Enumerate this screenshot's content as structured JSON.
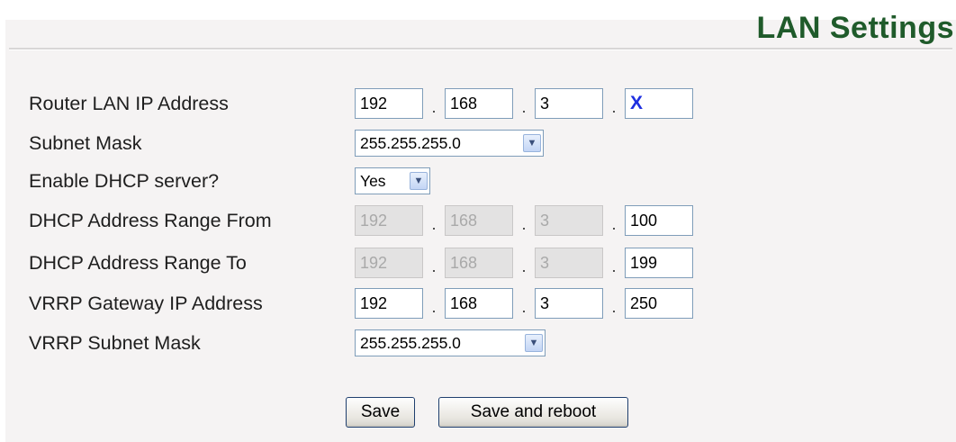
{
  "title": "LAN Settings",
  "rows": {
    "router_ip": {
      "label": "Router LAN IP Address",
      "octets": [
        "192",
        "168",
        "3",
        "X"
      ]
    },
    "subnet_mask": {
      "label": "Subnet Mask",
      "value": "255.255.255.0"
    },
    "dhcp_enable": {
      "label": "Enable DHCP server?",
      "value": "Yes"
    },
    "dhcp_from": {
      "label": "DHCP Address Range From",
      "octets": [
        "192",
        "168",
        "3",
        "100"
      ]
    },
    "dhcp_to": {
      "label": "DHCP Address Range To",
      "octets": [
        "192",
        "168",
        "3",
        "199"
      ]
    },
    "vrrp_ip": {
      "label": "VRRP Gateway IP Address",
      "octets": [
        "192",
        "168",
        "3",
        "250"
      ]
    },
    "vrrp_mask": {
      "label": "VRRP Subnet Mask",
      "value": "255.255.255.0"
    }
  },
  "separator": ".",
  "buttons": {
    "save": "Save",
    "save_reboot": "Save and reboot"
  },
  "colors": {
    "title": "#1f5a2a",
    "panel_background": "#f5f3f3",
    "accent_octet": "#1e2fe0"
  },
  "icons": {
    "dropdown": "chevron-down-icon"
  }
}
